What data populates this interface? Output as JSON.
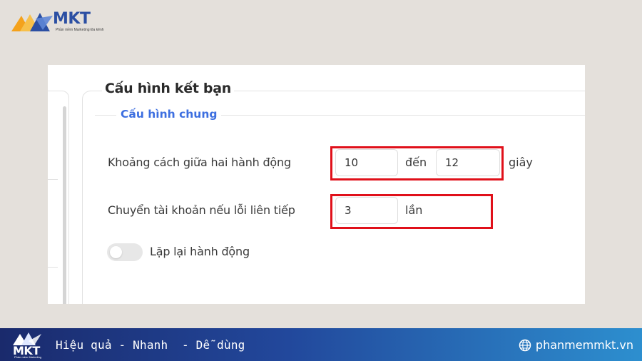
{
  "brand": {
    "logo_word": "MKT",
    "logo_sub": "Phần mềm Marketing Đa kênh",
    "accent": "#2b4fa3",
    "logo_orange": "#f4a21c"
  },
  "config": {
    "title": "Cấu hình kết bạn",
    "section_title": "Cấu hình chung",
    "interval": {
      "label": "Khoảng cách giữa hai hành động",
      "from_value": "10",
      "to_word": "đến",
      "to_value": "12",
      "unit": "giây"
    },
    "switch_account": {
      "label": "Chuyển tài khoản nếu lỗi liên tiếp",
      "value": "3",
      "unit": "lần"
    },
    "repeat": {
      "label": "Lặp lại hành động",
      "enabled": false
    },
    "highlight_color": "#e0101a"
  },
  "banner": {
    "logo_word": "MKT",
    "logo_sub": "Phần mềm Marketing",
    "slogan": "Hiệu quả - Nhanh  - Dễ dùng",
    "website": "phanmemmkt.vn"
  }
}
